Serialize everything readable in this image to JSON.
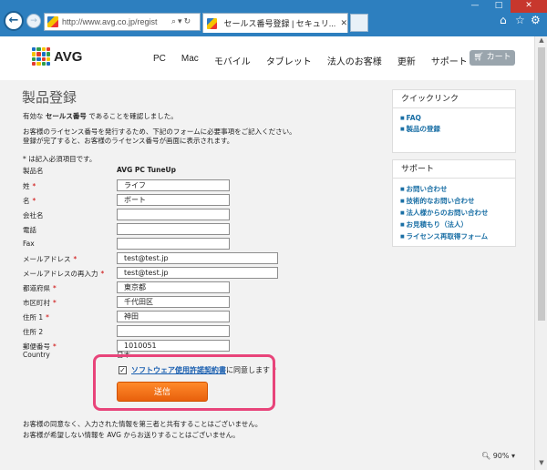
{
  "browser": {
    "url": "http://www.avg.co.jp/regist",
    "tab_title": "セールス番号登録 | セキュリ...",
    "window": {
      "minimize": "—",
      "maximize": "□",
      "close": "✕"
    },
    "zoom": "90%"
  },
  "header": {
    "logo": "AVG",
    "nav": [
      "PC",
      "Mac",
      "モバイル",
      "タブレット",
      "法人のお客様",
      "更新",
      "サポート"
    ],
    "cart": "カート"
  },
  "main": {
    "title": "製品登録",
    "intro1_prefix": "有効な ",
    "intro1_bold": "セールス番号",
    "intro1_suffix": " であることを確認しました。",
    "intro2": "お客様のライセンス番号を発行するため、下記のフォームに必要事項をご記入ください。",
    "intro3": "登録が完了すると、お客様のライセンス番号が画面に表示されます。",
    "required_note": "* は記入必須項目です。",
    "product_label": "製品名",
    "product_value": "AVG PC TuneUp",
    "fields": [
      {
        "label": "姓",
        "required": true,
        "value": "ライフ"
      },
      {
        "label": "名",
        "required": true,
        "value": "ボート"
      },
      {
        "label": "会社名",
        "required": false,
        "value": ""
      },
      {
        "label": "電話",
        "required": false,
        "value": ""
      },
      {
        "label": "Fax",
        "required": false,
        "value": ""
      },
      {
        "label": "メールアドレス",
        "required": true,
        "value": "test@test.jp"
      },
      {
        "label": "メールアドレスの再入力",
        "required": true,
        "value": "test@test.jp"
      },
      {
        "label": "都道府県",
        "required": true,
        "value": "東京都"
      },
      {
        "label": "市区町村",
        "required": true,
        "value": "千代田区"
      },
      {
        "label": "住所 1",
        "required": true,
        "value": "神田"
      },
      {
        "label": "住所 2",
        "required": false,
        "value": ""
      },
      {
        "label": "郵便番号",
        "required": true,
        "value": "1010051"
      }
    ],
    "country_label": "Country",
    "country_value": "日本",
    "agree_link": "ソフトウェア使用許諾契約書",
    "agree_suffix": " に同意します",
    "required_mark": "*",
    "submit": "送信",
    "footer1": "お客様の同意なく、入力された情報を第三者と共有することはございません。",
    "footer2": "お客様が希望しない情報を AVG からお送りすることはございません。"
  },
  "sidebar": {
    "quicklinks_title": "クイックリンク",
    "quicklinks": [
      "FAQ",
      "製品の登録"
    ],
    "support_title": "サポート",
    "support_links": [
      "お問い合わせ",
      "技術的なお問い合わせ",
      "法人様からのお問い合わせ",
      "お見積もり（法人）",
      "ライセンス再取得フォーム"
    ]
  },
  "colors": {
    "accent": "#f07214",
    "highlight": "#e8447a",
    "link": "#1a6fa5"
  }
}
